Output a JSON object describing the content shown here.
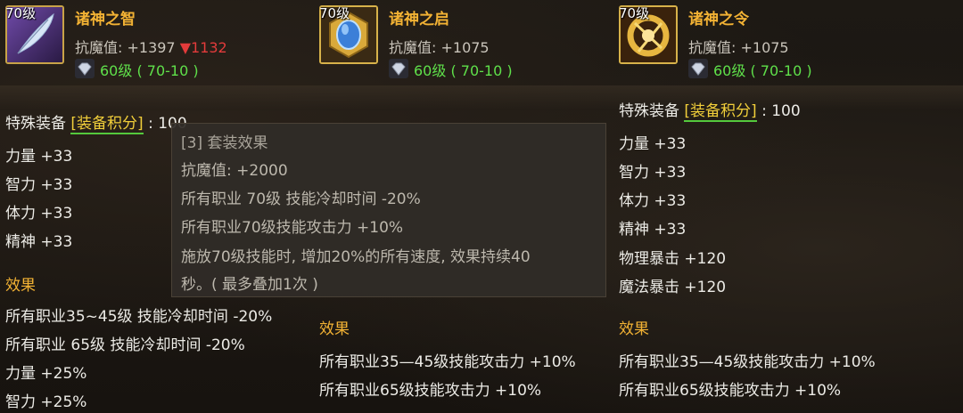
{
  "items": [
    {
      "level": "70级",
      "name": "诸神之智",
      "resist": "抗魔值: +1397",
      "resist_change": "▼1132",
      "requirement": "60级 ( 70-10 )",
      "special": "特殊装备",
      "special_tag": "[装备积分]",
      "special_value": ": 100",
      "stats": [
        "力量 +33",
        "智力 +33",
        "体力 +33",
        "精神 +33"
      ],
      "effect_title": "效果",
      "effects": [
        "所有职业35~45级 技能冷却时间 -20%",
        "所有职业 65级 技能冷却时间 -20%",
        "力量 +25%",
        "智力 +25%"
      ]
    },
    {
      "level": "70级",
      "name": "诸神之启",
      "resist": "抗魔值: +1075",
      "requirement": "60级 ( 70-10 )",
      "effect_title": "效果",
      "effects": [
        "所有职业35—45级技能攻击力 +10%",
        "所有职业65级技能攻击力 +10%"
      ]
    },
    {
      "level": "70级",
      "name": "诸神之令",
      "resist": "抗魔值: +1075",
      "requirement": "60级 ( 70-10 )",
      "special": "特殊装备",
      "special_tag": "[装备积分]",
      "special_value": ": 100",
      "stats": [
        "力量 +33",
        "智力 +33",
        "体力 +33",
        "精神 +33",
        "物理暴击 +120",
        "魔法暴击 +120"
      ],
      "effect_title": "效果",
      "effects": [
        "所有职业35—45级技能攻击力 +10%",
        "所有职业65级技能攻击力 +10%"
      ]
    }
  ],
  "tooltip": {
    "title": "[3] 套装效果",
    "lines": [
      "抗魔值: +2000",
      "所有职业 70级 技能冷却时间 -20%",
      "所有职业70级技能攻击力 +10%",
      "施放70级技能时, 增加20%的所有速度, 效果持续40",
      "秒。( 最多叠加1次 )"
    ]
  },
  "colors": {
    "name": "#f2b234",
    "requirement": "#5fe04a",
    "decrease": "#e33b3b",
    "tag": "#f2cf3a",
    "icon_border": "#c9a348"
  },
  "icons": [
    "feather-icon",
    "blue-gem-badge-icon",
    "gold-ornament-icon",
    "gem-icon"
  ]
}
